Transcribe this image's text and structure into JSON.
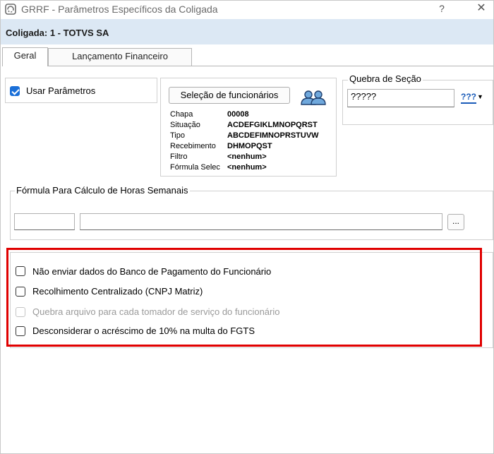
{
  "window": {
    "title": "GRRF - Parâmetros Específicos da Coligada",
    "help_label": "?",
    "close_label": "✕"
  },
  "header": {
    "coligada": "Coligada: 1 - TOTVS SA"
  },
  "tabs": [
    {
      "label": "Geral",
      "active": true
    },
    {
      "label": "Lançamento Financeiro",
      "active": false
    }
  ],
  "usar_parametros": {
    "label": "Usar Parâmetros",
    "checked": true
  },
  "selecao": {
    "button_label": "Seleção de funcionários",
    "fields": [
      {
        "label": "Chapa",
        "value": "00008"
      },
      {
        "label": "Situação",
        "value": "ACDEFGIKLMNOPQRST"
      },
      {
        "label": "Tipo",
        "value": "ABCDEFIMNOPRSTUVW"
      },
      {
        "label": "Recebimento",
        "value": "DHMOPQST"
      },
      {
        "label": "Filtro",
        "value": "<nenhum>"
      },
      {
        "label": "Fórmula Selec",
        "value": "<nenhum>"
      }
    ]
  },
  "quebra_secao": {
    "legend": "Quebra de Seção",
    "value": "?????",
    "picker_label": "???"
  },
  "formula": {
    "legend": "Fórmula Para Cálculo de Horas Semanais",
    "field1": "",
    "field2": "",
    "button_label": "..."
  },
  "options": [
    {
      "label": "Não enviar dados do Banco de Pagamento do Funcionário",
      "checked": false,
      "disabled": false
    },
    {
      "label": "Recolhimento Centralizado (CNPJ Matriz)",
      "checked": false,
      "disabled": false
    },
    {
      "label": "Quebra arquivo para cada tomador de serviço do funcionário",
      "checked": false,
      "disabled": true
    },
    {
      "label": "Desconsiderar o acréscimo de 10% na multa do FGTS",
      "checked": false,
      "disabled": false
    }
  ],
  "colors": {
    "highlight": "#e00000",
    "header_bg": "#dce8f4",
    "check_accent": "#1a6fd8"
  }
}
